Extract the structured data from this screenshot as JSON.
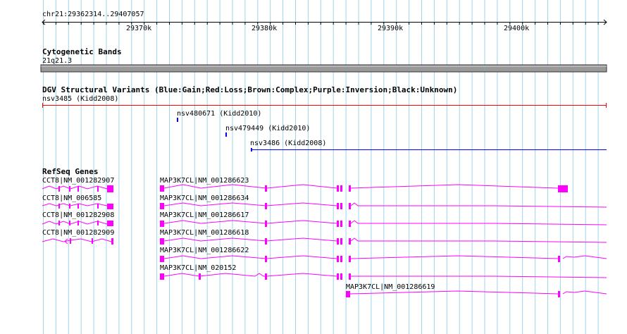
{
  "ruler": {
    "range_label": "chr21:29362314..29407057",
    "ticks": [
      "29370k",
      "29380k",
      "29390k",
      "29400k"
    ]
  },
  "cytoband": {
    "title": "Cytogenetic Bands",
    "band": "21q21.3"
  },
  "dgv": {
    "title": "DGV Structural Variants (Blue:Gain;Red:Loss;Brown:Complex;Purple:Inversion;Black:Unknown)",
    "variants": [
      {
        "label": "nsv3485 (Kidd2008)",
        "color": "#ff0000"
      },
      {
        "label": "nsv480671 (Kidd2010)",
        "color": "#0000ff"
      },
      {
        "label": "nsv479449 (Kidd2010)",
        "color": "#0000ff"
      },
      {
        "label": "nsv3486 (Kidd2008)",
        "color": "#0000ff"
      }
    ]
  },
  "refseq": {
    "title": "RefSeq Genes",
    "color": "#ff00ff",
    "genes": [
      {
        "label": "CCT8|NM_001282907"
      },
      {
        "label": "CCT8|NM_006585"
      },
      {
        "label": "CCT8|NM_001282908"
      },
      {
        "label": "CCT8|NM_001282909"
      },
      {
        "label": "MAP3K7CL|NM_001286623"
      },
      {
        "label": "MAP3K7CL|NM_001286634"
      },
      {
        "label": "MAP3K7CL|NM_001286617"
      },
      {
        "label": "MAP3K7CL|NM_001286618"
      },
      {
        "label": "MAP3K7CL|NM_001286622"
      },
      {
        "label": "MAP3K7CL|NM_020152"
      },
      {
        "label": "MAP3K7CL|NM_001286619"
      }
    ]
  },
  "colors": {
    "grid": "#9ed4ea",
    "cytoband_fill": "#999999",
    "gene": "#ff00ff"
  }
}
